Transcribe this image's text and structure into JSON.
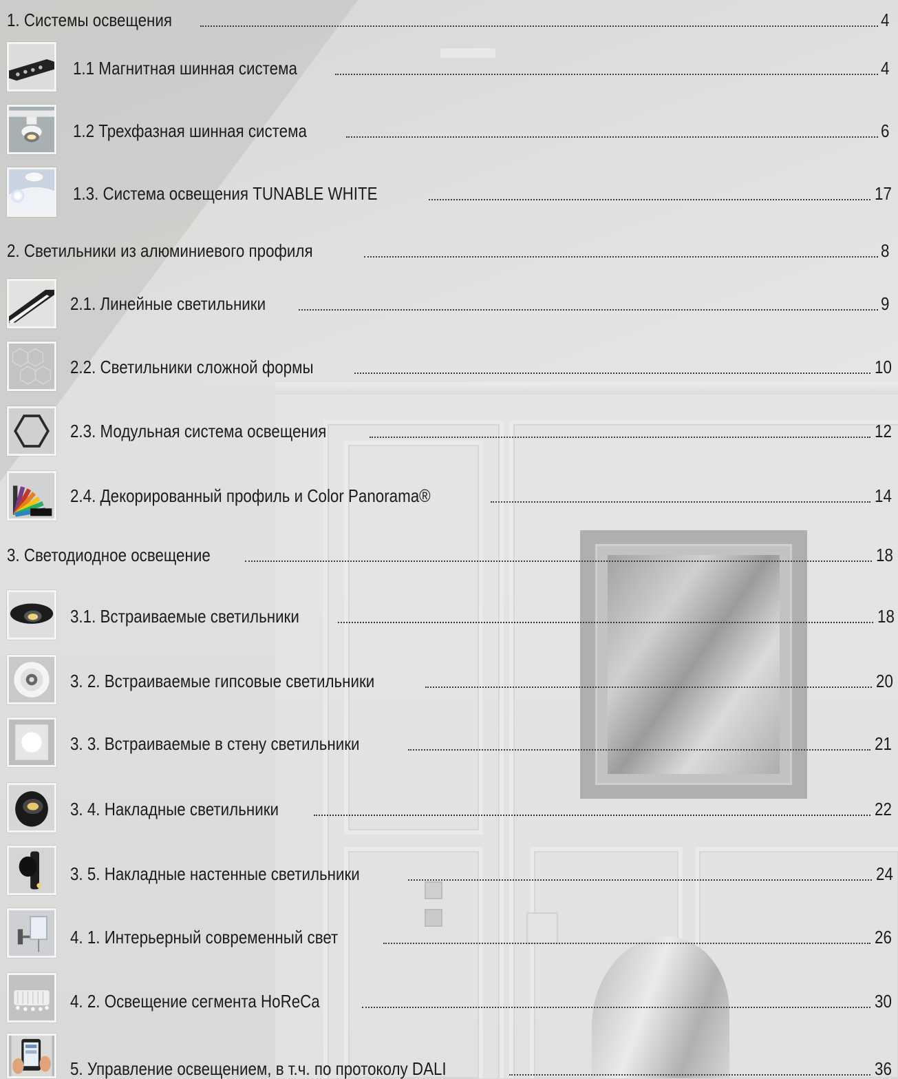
{
  "toc": [
    {
      "label": "1. Системы освещения",
      "page": "4"
    },
    {
      "label": "1.1 Магнитная шинная система",
      "page": "4",
      "icon": "magnetic-track-light-icon"
    },
    {
      "label": "1.2 Трехфазная шинная система",
      "page": "6",
      "icon": "three-phase-spotlight-icon"
    },
    {
      "label": "1.3. Система освещения TUNABLE WHITE",
      "page": "17",
      "icon": "tunable-white-light-icon"
    },
    {
      "label": "2. Светильники из алюминиевого профиля",
      "page": "8"
    },
    {
      "label": "2.1. Линейные светильники",
      "page": "9",
      "icon": "linear-luminaire-icon"
    },
    {
      "label": "2.2. Светильники сложной формы",
      "page": "10",
      "icon": "hexagon-grid-luminaire-icon"
    },
    {
      "label": "2.3. Модульная система освещения",
      "page": "12",
      "icon": "hexagon-module-icon"
    },
    {
      "label": "2.4. Декорированный профиль и Color Panorama®",
      "page": "14",
      "icon": "color-palette-fan-icon"
    },
    {
      "label": "3. Светодиодное освещение",
      "page": "18"
    },
    {
      "label": "3.1. Встраиваемые светильники",
      "page": "18",
      "icon": "recessed-spotlight-icon"
    },
    {
      "label": "3. 2.  Встраиваемые гипсовые светильники",
      "page": "20",
      "icon": "gypsum-recessed-light-icon"
    },
    {
      "label": "3. 3.  Встраиваемые в стену светильники",
      "page": "21",
      "icon": "wall-recessed-light-icon"
    },
    {
      "label": "3. 4. Накладные светильники",
      "page": "22",
      "icon": "surface-mounted-spot-icon"
    },
    {
      "label": "3. 5. Накладные настенные светильники",
      "page": "24",
      "icon": "wall-surface-spot-icon"
    },
    {
      "label": "4. 1. Интерьерный современный свет",
      "page": "26",
      "icon": "modern-wall-sconce-icon"
    },
    {
      "label": "4. 2. Освещение сегмента HoReCa",
      "page": "30",
      "icon": "horeca-chandelier-icon"
    },
    {
      "label": "5. Управление освещением, в т.ч. по протоколу DALI",
      "page": "36",
      "icon": "tablet-control-icon"
    }
  ]
}
